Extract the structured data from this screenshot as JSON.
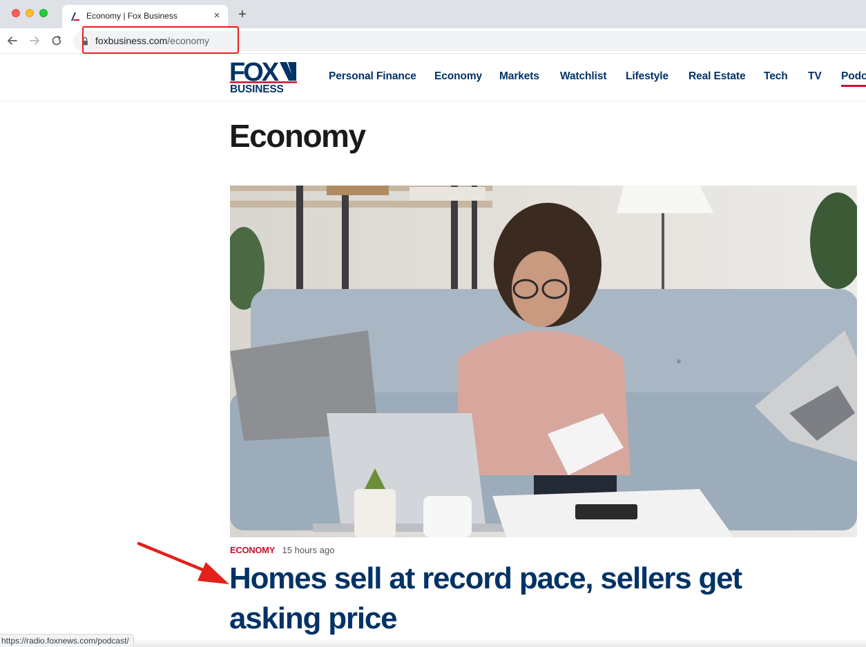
{
  "browser": {
    "tab_title": "Economy | Fox Business",
    "tab_close": "×",
    "new_tab": "+",
    "url_domain": "foxbusiness.com",
    "url_path": "/economy",
    "status_url": "https://radio.foxnews.com/podcast/"
  },
  "site": {
    "logo_top": "FOX",
    "logo_bottom": "BUSINESS",
    "nav": [
      {
        "label": "Personal Finance"
      },
      {
        "label": "Economy"
      },
      {
        "label": "Markets"
      },
      {
        "label": "Watchlist"
      },
      {
        "label": "Lifestyle"
      },
      {
        "label": "Real Estate"
      },
      {
        "label": "Tech"
      },
      {
        "label": "TV"
      },
      {
        "label": "Podc"
      }
    ]
  },
  "page": {
    "title": "Economy",
    "lead_story": {
      "kicker": "ECONOMY",
      "time": "15 hours ago",
      "headline": "Homes sell at record pace, sellers get asking price"
    }
  },
  "colors": {
    "brand_navy": "#003366",
    "brand_red": "#c8102e",
    "annotation_red": "#e3201b"
  }
}
